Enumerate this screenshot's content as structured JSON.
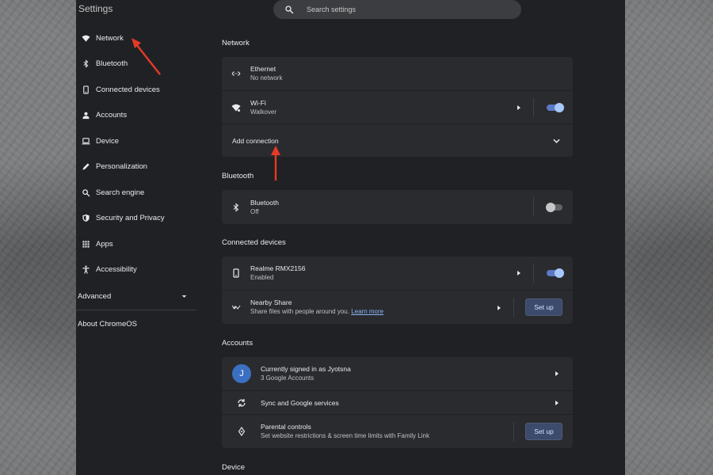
{
  "app": {
    "title": "Settings"
  },
  "search": {
    "placeholder": "Search settings"
  },
  "sidebar": {
    "items": [
      {
        "label": "Network",
        "icon": "wifi-icon"
      },
      {
        "label": "Bluetooth",
        "icon": "bluetooth-icon"
      },
      {
        "label": "Connected devices",
        "icon": "phone-icon"
      },
      {
        "label": "Accounts",
        "icon": "person-icon"
      },
      {
        "label": "Device",
        "icon": "laptop-icon"
      },
      {
        "label": "Personalization",
        "icon": "pen-icon"
      },
      {
        "label": "Search engine",
        "icon": "search-icon"
      },
      {
        "label": "Security and Privacy",
        "icon": "shield-icon"
      },
      {
        "label": "Apps",
        "icon": "apps-grid-icon"
      },
      {
        "label": "Accessibility",
        "icon": "accessibility-icon"
      }
    ],
    "advanced_label": "Advanced",
    "about_label": "About ChromeOS"
  },
  "network": {
    "title": "Network",
    "ethernet": {
      "name": "Ethernet",
      "status": "No network"
    },
    "wifi": {
      "name": "Wi-Fi",
      "status": "Walkover",
      "enabled": true
    },
    "add_connection": "Add connection"
  },
  "bluetooth": {
    "title": "Bluetooth",
    "name": "Bluetooth",
    "status": "Off",
    "enabled": false
  },
  "connected_devices": {
    "title": "Connected devices",
    "phone": {
      "name": "Realme RMX2156",
      "status": "Enabled",
      "enabled": true
    },
    "nearby": {
      "name": "Nearby Share",
      "desc": "Share files with people around you.",
      "link": "Learn more",
      "button": "Set up"
    }
  },
  "accounts": {
    "title": "Accounts",
    "signed_in": {
      "initial": "J",
      "name": "Currently signed in as Jyotsna",
      "sub": "3 Google Accounts"
    },
    "sync": "Sync and Google services",
    "parental": {
      "name": "Parental controls",
      "desc": "Set website restrictions & screen time limits with Family Link",
      "button": "Set up"
    }
  },
  "device": {
    "title": "Device"
  },
  "colors": {
    "background": "#202124",
    "card": "#2a2b2e",
    "accent": "#a8c7fa",
    "annotation_arrow": "#e53a26"
  }
}
